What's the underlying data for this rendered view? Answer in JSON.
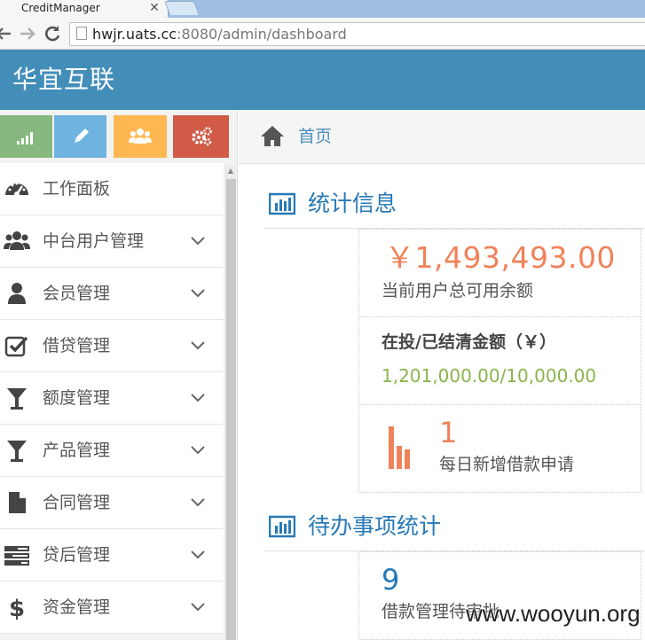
{
  "browser": {
    "tab_title": "CreditManager",
    "tab_close": "✕",
    "url_host": "hwjr.uats.cc",
    "url_rest": ":8080/admin/dashboard"
  },
  "app": {
    "brand": "华宜互联"
  },
  "colors": {
    "header": "#438eb9",
    "shortcut_success": "#87b87f",
    "shortcut_info": "#6fb3e0",
    "shortcut_warning": "#ffb752",
    "shortcut_danger": "#d15b47",
    "accent_blue": "#2679b5",
    "orange": "#f0825a",
    "green": "#8ab54b"
  },
  "shortcuts": [
    {
      "icon": "signal-icon"
    },
    {
      "icon": "pencil-icon"
    },
    {
      "icon": "users-icon"
    },
    {
      "icon": "cogs-icon"
    }
  ],
  "sidebar": {
    "items": [
      {
        "label": "工作面板",
        "icon": "tachometer-icon",
        "has_submenu": false
      },
      {
        "label": "中台用户管理",
        "icon": "users-icon",
        "has_submenu": true
      },
      {
        "label": "会员管理",
        "icon": "user-icon",
        "has_submenu": true
      },
      {
        "label": "借贷管理",
        "icon": "check-square-icon",
        "has_submenu": true
      },
      {
        "label": "额度管理",
        "icon": "filter-icon",
        "has_submenu": true
      },
      {
        "label": "产品管理",
        "icon": "filter-icon",
        "has_submenu": true
      },
      {
        "label": "合同管理",
        "icon": "file-icon",
        "has_submenu": true
      },
      {
        "label": "贷后管理",
        "icon": "tasks-icon",
        "has_submenu": true
      },
      {
        "label": "资金管理",
        "icon": "dollar-icon",
        "has_submenu": true
      }
    ]
  },
  "breadcrumb": {
    "home": "首页"
  },
  "stats": {
    "title": "统计信息",
    "balance_amount": "￥1,493,493.00",
    "balance_label": "当前用户总可用余额",
    "invest_title": "在投/已结清金额（￥）",
    "invest_value": "1,201,000.00/10,000.00",
    "daily_count": "1",
    "daily_label": "每日新增借款申请"
  },
  "todo": {
    "title": "待办事项统计",
    "count": "9",
    "label": "借款管理待审批"
  },
  "watermark": "www.wooyun.org"
}
